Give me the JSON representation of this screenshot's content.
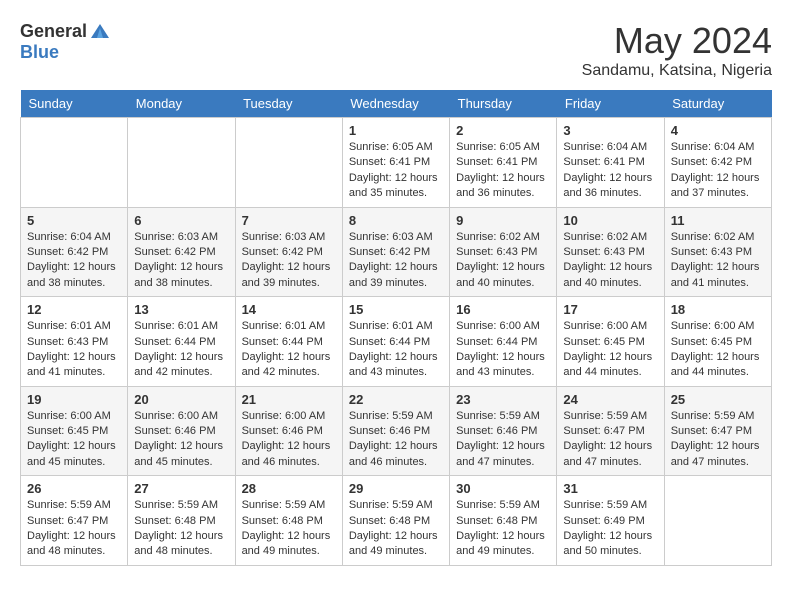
{
  "header": {
    "logo_general": "General",
    "logo_blue": "Blue",
    "month_year": "May 2024",
    "location": "Sandamu, Katsina, Nigeria"
  },
  "days_of_week": [
    "Sunday",
    "Monday",
    "Tuesday",
    "Wednesday",
    "Thursday",
    "Friday",
    "Saturday"
  ],
  "weeks": [
    [
      {
        "day": "",
        "content": ""
      },
      {
        "day": "",
        "content": ""
      },
      {
        "day": "",
        "content": ""
      },
      {
        "day": "1",
        "content": "Sunrise: 6:05 AM\nSunset: 6:41 PM\nDaylight: 12 hours\nand 35 minutes."
      },
      {
        "day": "2",
        "content": "Sunrise: 6:05 AM\nSunset: 6:41 PM\nDaylight: 12 hours\nand 36 minutes."
      },
      {
        "day": "3",
        "content": "Sunrise: 6:04 AM\nSunset: 6:41 PM\nDaylight: 12 hours\nand 36 minutes."
      },
      {
        "day": "4",
        "content": "Sunrise: 6:04 AM\nSunset: 6:42 PM\nDaylight: 12 hours\nand 37 minutes."
      }
    ],
    [
      {
        "day": "5",
        "content": "Sunrise: 6:04 AM\nSunset: 6:42 PM\nDaylight: 12 hours\nand 38 minutes."
      },
      {
        "day": "6",
        "content": "Sunrise: 6:03 AM\nSunset: 6:42 PM\nDaylight: 12 hours\nand 38 minutes."
      },
      {
        "day": "7",
        "content": "Sunrise: 6:03 AM\nSunset: 6:42 PM\nDaylight: 12 hours\nand 39 minutes."
      },
      {
        "day": "8",
        "content": "Sunrise: 6:03 AM\nSunset: 6:42 PM\nDaylight: 12 hours\nand 39 minutes."
      },
      {
        "day": "9",
        "content": "Sunrise: 6:02 AM\nSunset: 6:43 PM\nDaylight: 12 hours\nand 40 minutes."
      },
      {
        "day": "10",
        "content": "Sunrise: 6:02 AM\nSunset: 6:43 PM\nDaylight: 12 hours\nand 40 minutes."
      },
      {
        "day": "11",
        "content": "Sunrise: 6:02 AM\nSunset: 6:43 PM\nDaylight: 12 hours\nand 41 minutes."
      }
    ],
    [
      {
        "day": "12",
        "content": "Sunrise: 6:01 AM\nSunset: 6:43 PM\nDaylight: 12 hours\nand 41 minutes."
      },
      {
        "day": "13",
        "content": "Sunrise: 6:01 AM\nSunset: 6:44 PM\nDaylight: 12 hours\nand 42 minutes."
      },
      {
        "day": "14",
        "content": "Sunrise: 6:01 AM\nSunset: 6:44 PM\nDaylight: 12 hours\nand 42 minutes."
      },
      {
        "day": "15",
        "content": "Sunrise: 6:01 AM\nSunset: 6:44 PM\nDaylight: 12 hours\nand 43 minutes."
      },
      {
        "day": "16",
        "content": "Sunrise: 6:00 AM\nSunset: 6:44 PM\nDaylight: 12 hours\nand 43 minutes."
      },
      {
        "day": "17",
        "content": "Sunrise: 6:00 AM\nSunset: 6:45 PM\nDaylight: 12 hours\nand 44 minutes."
      },
      {
        "day": "18",
        "content": "Sunrise: 6:00 AM\nSunset: 6:45 PM\nDaylight: 12 hours\nand 44 minutes."
      }
    ],
    [
      {
        "day": "19",
        "content": "Sunrise: 6:00 AM\nSunset: 6:45 PM\nDaylight: 12 hours\nand 45 minutes."
      },
      {
        "day": "20",
        "content": "Sunrise: 6:00 AM\nSunset: 6:46 PM\nDaylight: 12 hours\nand 45 minutes."
      },
      {
        "day": "21",
        "content": "Sunrise: 6:00 AM\nSunset: 6:46 PM\nDaylight: 12 hours\nand 46 minutes."
      },
      {
        "day": "22",
        "content": "Sunrise: 5:59 AM\nSunset: 6:46 PM\nDaylight: 12 hours\nand 46 minutes."
      },
      {
        "day": "23",
        "content": "Sunrise: 5:59 AM\nSunset: 6:46 PM\nDaylight: 12 hours\nand 47 minutes."
      },
      {
        "day": "24",
        "content": "Sunrise: 5:59 AM\nSunset: 6:47 PM\nDaylight: 12 hours\nand 47 minutes."
      },
      {
        "day": "25",
        "content": "Sunrise: 5:59 AM\nSunset: 6:47 PM\nDaylight: 12 hours\nand 47 minutes."
      }
    ],
    [
      {
        "day": "26",
        "content": "Sunrise: 5:59 AM\nSunset: 6:47 PM\nDaylight: 12 hours\nand 48 minutes."
      },
      {
        "day": "27",
        "content": "Sunrise: 5:59 AM\nSunset: 6:48 PM\nDaylight: 12 hours\nand 48 minutes."
      },
      {
        "day": "28",
        "content": "Sunrise: 5:59 AM\nSunset: 6:48 PM\nDaylight: 12 hours\nand 49 minutes."
      },
      {
        "day": "29",
        "content": "Sunrise: 5:59 AM\nSunset: 6:48 PM\nDaylight: 12 hours\nand 49 minutes."
      },
      {
        "day": "30",
        "content": "Sunrise: 5:59 AM\nSunset: 6:48 PM\nDaylight: 12 hours\nand 49 minutes."
      },
      {
        "day": "31",
        "content": "Sunrise: 5:59 AM\nSunset: 6:49 PM\nDaylight: 12 hours\nand 50 minutes."
      },
      {
        "day": "",
        "content": ""
      }
    ]
  ]
}
